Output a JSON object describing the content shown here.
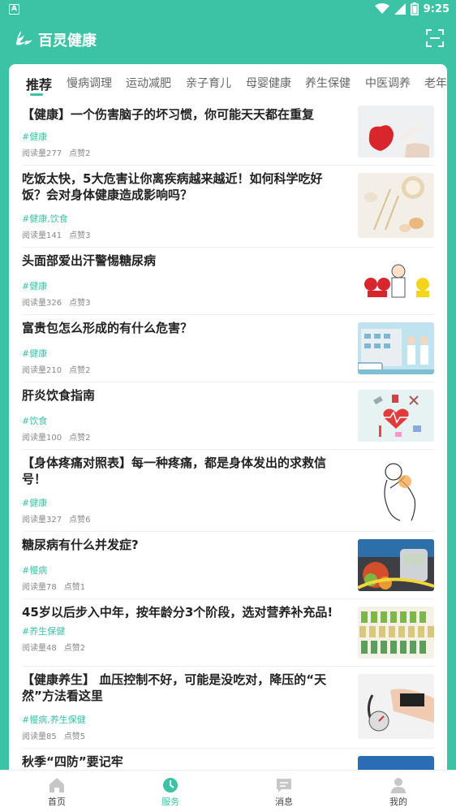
{
  "status": {
    "notification_glyph": "A",
    "time": "9:25"
  },
  "app": {
    "title": "百灵健康"
  },
  "tabs": [
    "推荐",
    "慢病调理",
    "运动减肥",
    "亲子育儿",
    "母婴健康",
    "养生保健",
    "中医调养",
    "老年"
  ],
  "articles": [
    {
      "title": "【健康】一个伤害脑子的坏习惯，你可能天天都在重复",
      "tag": "#健康",
      "reads": "阅读量277",
      "likes": "点赞2"
    },
    {
      "title": "吃饭太快，5大危害让你离疾病越来越近！如何科学吃好饭？会对身体健康造成影响吗？",
      "tag": "#健康,饮食",
      "reads": "阅读量141",
      "likes": "点赞3"
    },
    {
      "title": "头面部爱出汗警惕糖尿病",
      "tag": "#健康",
      "reads": "阅读量326",
      "likes": "点赞3"
    },
    {
      "title": "富贵包怎么形成的有什么危害？",
      "tag": "#健康",
      "reads": "阅读量210",
      "likes": "点赞2"
    },
    {
      "title": "肝炎饮食指南",
      "tag": "#饮食",
      "reads": "阅读量100",
      "likes": "点赞2"
    },
    {
      "title": "【身体疼痛对照表】每一种疼痛，都是身体发出的求救信号！",
      "tag": "#健康",
      "reads": "阅读量327",
      "likes": "点赞6"
    },
    {
      "title": "糖尿病有什么并发症?",
      "tag": "#慢病",
      "reads": "阅读量78",
      "likes": "点赞1"
    },
    {
      "title": "45岁以后步入中年，按年龄分3个阶段，选对营养补充品!",
      "tag": "#养生保健",
      "reads": "阅读量48",
      "likes": "点赞2"
    },
    {
      "title": "【健康养生】 血压控制不好，可能是没吃对，降压的“天然”方法看这里",
      "tag": "#慢病,养生保健",
      "reads": "阅读量85",
      "likes": "点赞5"
    },
    {
      "title": "秋季“四防”要记牢",
      "tag": "",
      "reads": "",
      "likes": ""
    }
  ],
  "bottom_nav": {
    "home": "首页",
    "service": "服务",
    "message": "消息",
    "mine": "我的"
  },
  "colors": {
    "accent": "#3cc2a5",
    "text": "#222222",
    "muted": "#888888"
  },
  "icons": [
    "wifi-icon",
    "signal-icon",
    "battery-icon",
    "app-logo-icon",
    "scan-icon",
    "home-icon",
    "service-icon",
    "message-icon",
    "user-icon"
  ]
}
